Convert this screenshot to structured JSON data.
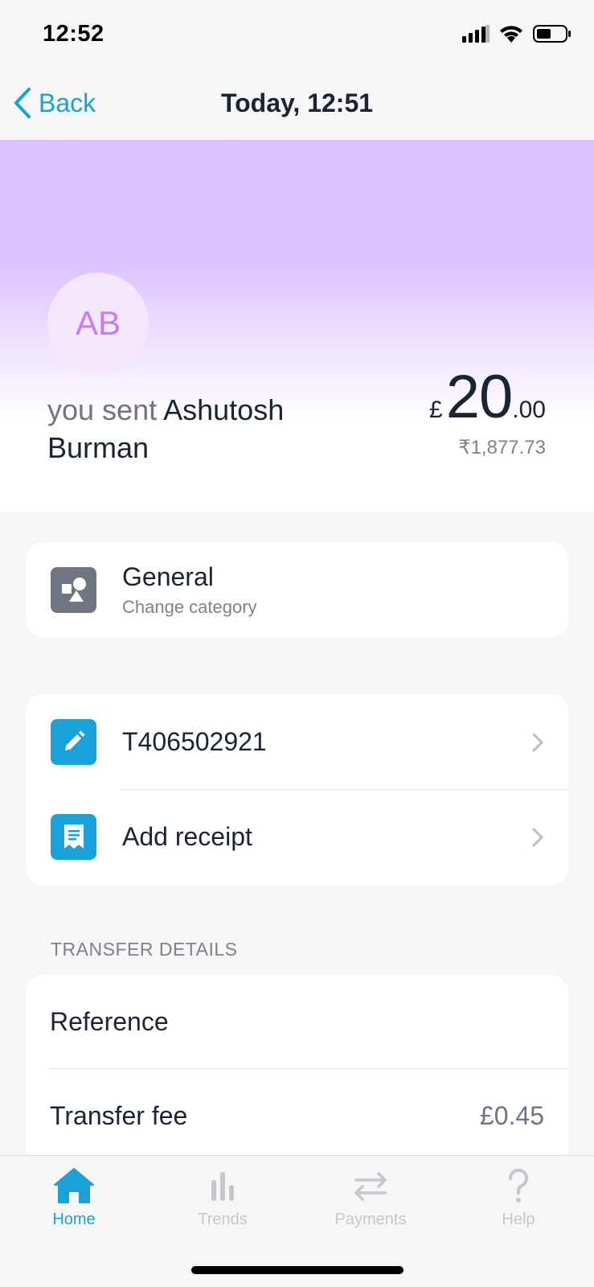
{
  "status_bar": {
    "time": "12:52"
  },
  "nav": {
    "back_label": "Back",
    "title": "Today, 12:51"
  },
  "header": {
    "avatar_initials": "AB",
    "sent_prefix": "you sent",
    "recipient_name": "Ashutosh Burman",
    "amount_currency": "£",
    "amount_major": "20",
    "amount_minor": ".00",
    "converted_amount": "₹1,877.73",
    "gradient_color": "#dcc2fe"
  },
  "category": {
    "title": "General",
    "subtitle": "Change category"
  },
  "actions": [
    {
      "label": "T406502921",
      "icon": "pencil-icon"
    },
    {
      "label": "Add receipt",
      "icon": "receipt-icon"
    }
  ],
  "transfer_details": {
    "section_label": "TRANSFER DETAILS",
    "rows": [
      {
        "label": "Reference",
        "value": ""
      },
      {
        "label": "Transfer fee",
        "value": "£0.45"
      }
    ]
  },
  "tab_bar": {
    "tabs": [
      {
        "label": "Home",
        "icon": "home-icon",
        "active": true
      },
      {
        "label": "Trends",
        "icon": "trends-icon",
        "active": false
      },
      {
        "label": "Payments",
        "icon": "payments-icon",
        "active": false
      },
      {
        "label": "Help",
        "icon": "help-icon",
        "active": false
      }
    ]
  },
  "colors": {
    "accent": "#1aa1d8",
    "text_primary": "#1b2433",
    "text_secondary": "#7c828d"
  }
}
